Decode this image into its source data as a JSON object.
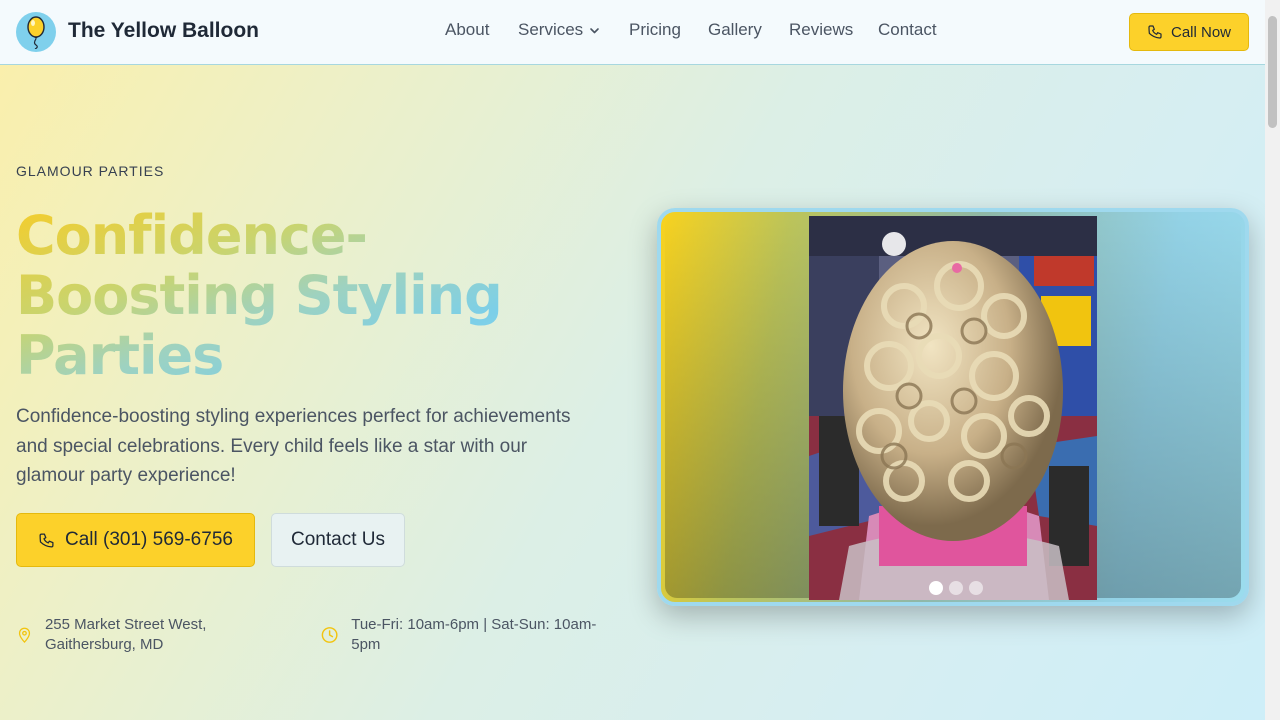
{
  "header": {
    "brand": "The Yellow Balloon",
    "nav": [
      {
        "label": "About"
      },
      {
        "label": "Services"
      },
      {
        "label": "Pricing"
      },
      {
        "label": "Gallery"
      },
      {
        "label": "Reviews"
      },
      {
        "label": "Contact"
      }
    ],
    "call_now": "Call Now"
  },
  "hero": {
    "eyebrow": "GLAMOUR PARTIES",
    "title": "Confidence-Boosting Styling Parties",
    "description": "Confidence-boosting styling experiences perfect for achievements and special celebrations. Every child feels like a star with our glamour party experience!",
    "call_button": "Call (301) 569-6756",
    "contact_button": "Contact Us",
    "address": "255 Market Street West, Gaithersburg, MD",
    "hours": "Tue-Fri: 10am-6pm | Sat-Sun: 10am-5pm"
  },
  "carousel": {
    "slide_count": 3,
    "active_slide": 1
  },
  "colors": {
    "accent_yellow": "#fcd12a",
    "sky_blue": "#7fd0ec"
  },
  "icons": [
    "balloon-icon",
    "chevron-down-icon",
    "phone-icon",
    "map-pin-icon",
    "clock-icon"
  ]
}
